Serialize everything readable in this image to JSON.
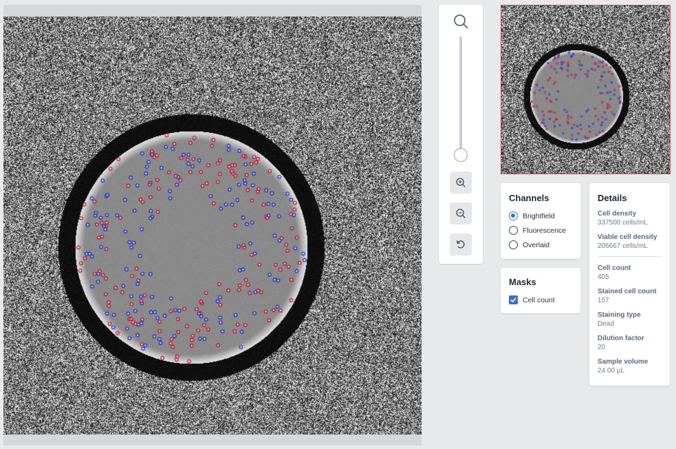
{
  "viewer": {
    "image_name": "hemocytometer-brightfield"
  },
  "zoom": {
    "level": 0.0
  },
  "channels": {
    "title": "Channels",
    "options": [
      {
        "label": "Brightfield",
        "selected": true
      },
      {
        "label": "Fluorescence",
        "selected": false
      },
      {
        "label": "Overlaid",
        "selected": false
      }
    ]
  },
  "masks": {
    "title": "Masks",
    "items": [
      {
        "label": "Cell count",
        "checked": true
      }
    ]
  },
  "details": {
    "title": "Details",
    "group1": [
      {
        "label": "Cell density",
        "value": "337500 cells/mL"
      },
      {
        "label": "Viable cell density",
        "value": "206667 cells/mL"
      }
    ],
    "group2": [
      {
        "label": "Cell count",
        "value": "405"
      },
      {
        "label": "Stained cell count",
        "value": "157"
      },
      {
        "label": "Staining type",
        "value": "Dead"
      },
      {
        "label": "Dilution factor",
        "value": "20"
      },
      {
        "label": "Sample volume",
        "value": "24.00 µL"
      }
    ]
  },
  "colors": {
    "accent": "#3a6fd0",
    "minimap_border": "#cf4a4a",
    "marker_red": "#c8103a",
    "marker_blue": "#2030d0"
  },
  "icons": {
    "zoom": "search-icon",
    "zoom_in": "zoom-in-icon",
    "zoom_out": "zoom-out-icon",
    "reset": "reset-rotate-icon"
  }
}
